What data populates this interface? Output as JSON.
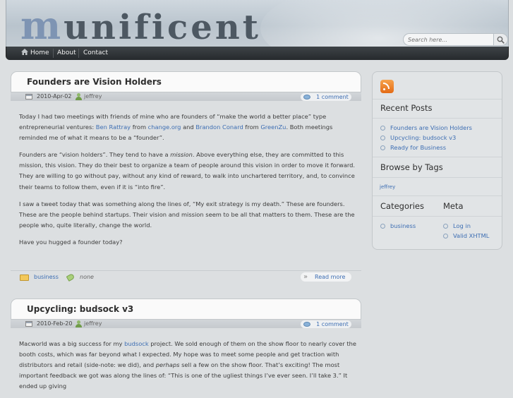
{
  "site": {
    "logo_first": "m",
    "logo_rest": "unificent"
  },
  "search": {
    "placeholder": "Search here..."
  },
  "nav": {
    "home": "Home",
    "about": "About",
    "contact": "Contact"
  },
  "posts": [
    {
      "title": "Founders are Vision Holders",
      "date": "2010-Apr-02",
      "author": "jeffrey",
      "comments": "1 comment",
      "p1": {
        "a": "Today I had two meetings with friends of mine who are founders of “make the world a better place” type entrepreneurial ventures: ",
        "l1": "Ben Rattray",
        "b": " from ",
        "l2": "change.org",
        "c": " and ",
        "l3": "Brandon Conard",
        "d": " from ",
        "l4": "GreenZu",
        "e": ". Both meetings reminded me of what it means to be a “founder”."
      },
      "p2": {
        "a": "Founders are “vision holders”. They tend to have a ",
        "em": "mission",
        "b": ". Above everything else, they are committed to this mission, this vision. They do their best to organize a team of people around this vision in order to move it forward. They are willing to go without pay, without any kind of reward, to walk into unchartered territory, and, to convince their teams to follow them, even if it is “into fire”."
      },
      "p3": "I saw a tweet today that was something along the lines of, “My exit strategy is my death.” These are founders. These are the people behind startups. Their vision and mission seem to be all that matters to them. These are the people who, quite literally, change the world.",
      "p4": "Have you hugged a founder today?",
      "category": "business",
      "tags": "none",
      "read_more": "Read more"
    },
    {
      "title": "Upcycling: budsock v3",
      "date": "2010-Feb-20",
      "author": "jeffrey",
      "comments": "1 comment",
      "p1": {
        "a": "Macworld was a big success for my ",
        "l1": "budsock",
        "b": " project. We sold enough of them on the show floor to nearly cover the booth costs, which was far beyond what I expected. My hope was to meet some people and get traction with distributors and retail (side-note: we did), and ",
        "em": "perhaps",
        "c": " sell a few on the show floor. That’s exciting! The most important feedback we got was along the lines of: “This is one of the ugliest things I’ve ever seen. I’ll take 3.” It ended up giving"
      }
    }
  ],
  "sidebar": {
    "recent_title": "Recent Posts",
    "recent": [
      "Founders are Vision Holders",
      "Upcycling: budsock v3",
      "Ready for Business"
    ],
    "tags_title": "Browse by Tags",
    "tag_cloud": "jeffrey",
    "categories_title": "Categories",
    "categories": [
      "business"
    ],
    "meta_title": "Meta",
    "meta": [
      "Log in",
      "Valid XHTML"
    ]
  },
  "icons": [
    "home-icon",
    "search-icon",
    "rss-icon",
    "calendar-icon",
    "user-icon",
    "comment-icon",
    "folder-icon",
    "tag-icon",
    "read-more-arrow-icon"
  ]
}
